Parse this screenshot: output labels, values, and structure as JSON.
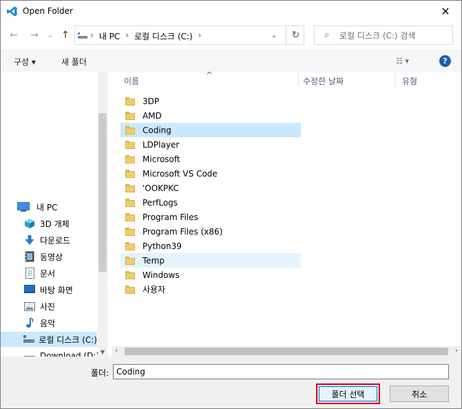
{
  "window": {
    "title": "Open Folder",
    "close_glyph": "✕"
  },
  "nav": {
    "back_glyph": "←",
    "forward_glyph": "→",
    "history_glyph": "⌄",
    "up_glyph": "↑",
    "breadcrumbs": [
      "내 PC",
      "로컬 디스크 (C:)"
    ],
    "breadcrumb_sep": "›",
    "address_dropdown_glyph": "⌄",
    "refresh_glyph": "↻",
    "search_icon": "⌕",
    "search_placeholder": "로컬 디스크 (C:) 검색"
  },
  "commands": {
    "organize": "구성 ▾",
    "new_folder": "새 폴더",
    "view_glyph": "☷ ▾",
    "help": "?"
  },
  "sidebar": {
    "items": [
      {
        "label": "내 PC",
        "icon": "pc-icon"
      },
      {
        "label": "3D 개체",
        "icon": "3d-objects-icon"
      },
      {
        "label": "다운로드",
        "icon": "download-icon"
      },
      {
        "label": "동영상",
        "icon": "video-icon"
      },
      {
        "label": "문서",
        "icon": "document-icon"
      },
      {
        "label": "바탕 화면",
        "icon": "desktop-icon"
      },
      {
        "label": "사진",
        "icon": "pictures-icon"
      },
      {
        "label": "음악",
        "icon": "music-icon"
      },
      {
        "label": "로컬 디스크 (C:)",
        "icon": "drive-icon"
      },
      {
        "label": "Download (D:)",
        "icon": "drive-icon"
      }
    ]
  },
  "columns": {
    "name": "이름",
    "sort_glyph": "^",
    "modified": "수정한 날짜",
    "type": "유형"
  },
  "files": [
    {
      "name": "3DP",
      "state": ""
    },
    {
      "name": "AMD",
      "state": ""
    },
    {
      "name": "Coding",
      "state": "selected"
    },
    {
      "name": "LDPlayer",
      "state": ""
    },
    {
      "name": "Microsoft",
      "state": ""
    },
    {
      "name": "Microsoft VS Code",
      "state": ""
    },
    {
      "name": "'OOKPKC",
      "state": ""
    },
    {
      "name": "PerfLogs",
      "state": ""
    },
    {
      "name": "Program Files",
      "state": ""
    },
    {
      "name": "Program Files (x86)",
      "state": ""
    },
    {
      "name": "Python39",
      "state": ""
    },
    {
      "name": "Temp",
      "state": "hover"
    },
    {
      "name": "Windows",
      "state": ""
    },
    {
      "name": "사용자",
      "state": ""
    }
  ],
  "footer": {
    "folder_label": "폴더:",
    "folder_value": "Coding",
    "select_button": "폴더 선택",
    "cancel_button": "취소"
  },
  "colors": {
    "accent": "#0078d7",
    "selection": "#cce8ff",
    "hover": "#e5f3ff",
    "highlight_border": "#d9001b"
  }
}
